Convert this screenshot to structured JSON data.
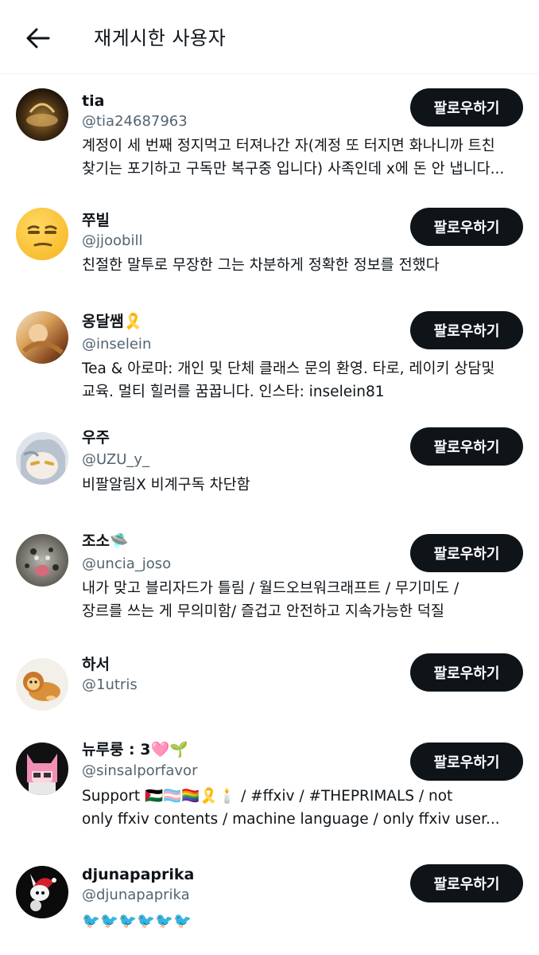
{
  "header": {
    "title": "재게시한 사용자",
    "back_icon": "arrow-left-icon"
  },
  "follow_label": "팔로우하기",
  "users": [
    {
      "name": "tia",
      "handle": "@tia24687963",
      "bio": [
        "계정이 세 번째 정지먹고 터져나간 자(계정 또 터지면 화나니까 트친",
        "찾기는 포기하고 구독만 복구중 입니다) 사족인데 x에 돈 안 냅니다..."
      ]
    },
    {
      "name": "쭈빌",
      "handle": "@jjoobill",
      "bio": [
        "친절한 말투로 무장한 그는 차분하게 정확한 정보를 전했다"
      ]
    },
    {
      "name": "옹달쌤🎗️",
      "handle": "@inselein",
      "bio": [
        "Tea & 아로마: 개인 및 단체 클래스 문의 환영. 타로, 레이키 상담및",
        "교육. 멀티 힐러를 꿈꿉니다.  인스타: inselein81"
      ]
    },
    {
      "name": "우주",
      "handle": "@UZU_y_",
      "bio": [
        "비팔알림X 비계구독 차단함"
      ]
    },
    {
      "name": "조소🛸",
      "handle": "@uncia_joso",
      "bio": [
        "내가 맞고 블리자드가 틀림 / 월드오브워크래프트 / 무기미도 /",
        "장르를 쓰는 게 무의미함/ 즐겁고 안전하고 지속가능한 덕질"
      ]
    },
    {
      "name": "하서",
      "handle": "@1utris",
      "bio": []
    },
    {
      "name": "뉴루룽 : 3🩷🌱",
      "handle": "@sinsalporfavor",
      "bio": [
        "Support 🇵🇸🏳️‍⚧️🏳️‍🌈🎗️🕯️ / #ffxiv / #THEPRIMALS / not",
        "only ffxiv contents / machine language / only ffxiv user..."
      ]
    },
    {
      "name": "djunapaprika",
      "handle": "@djunapaprika",
      "bio": [
        "🐦🐦🐦🐦🐦🐦"
      ]
    }
  ]
}
